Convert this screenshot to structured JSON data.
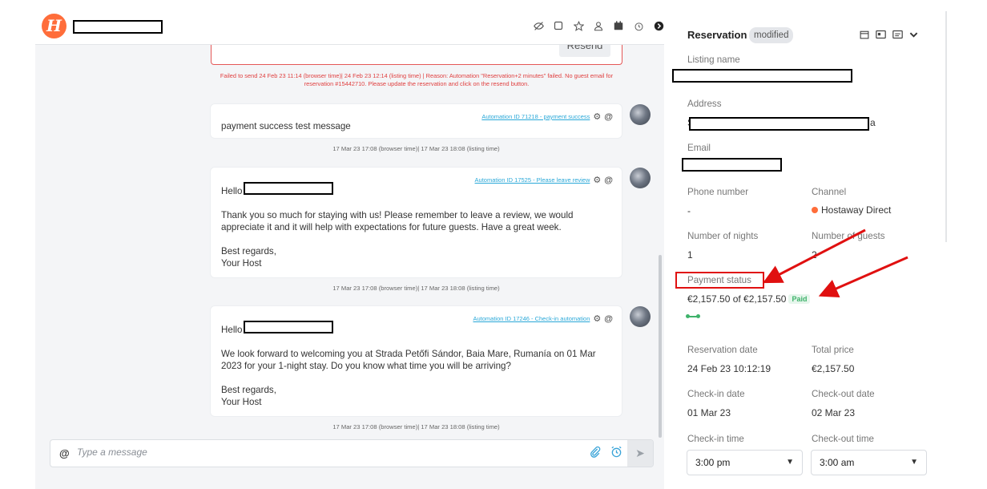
{
  "top_icons": [
    "eye-off-icon",
    "note-icon",
    "star-icon",
    "user-icon",
    "calendar-icon",
    "alarm-icon",
    "arrow-circle-icon"
  ],
  "failed_notice": {
    "resend_label": "Resend",
    "text": "Failed to send 24 Feb 23 11:14  (browser time)|  24 Feb 23 12:14 (listing time)  | Reason: Automation \"Reservation+2 minutes\" failed. No guest email for reservation #15442710. Please update the reservation and click on the resend button."
  },
  "messages": [
    {
      "automation": "Automation ID 71218  -  payment success",
      "greeting": "",
      "paragraphs": [
        "payment success test message"
      ],
      "signature": [],
      "timestamp": "17 Mar 23 17:08  (browser time)|  17 Mar 23 18:08 (listing time)"
    },
    {
      "automation": "Automation ID 17525  -  Please leave review",
      "greeting": "Hello",
      "paragraphs": [
        "Thank you so much for staying with us! Please remember to leave a review, we would appreciate it and it will help with expectations for future guests. Have a great week."
      ],
      "signature": [
        "Best regards,",
        "Your Host"
      ],
      "timestamp": "17 Mar 23 17:08  (browser time)|  17 Mar 23 18:08 (listing time)"
    },
    {
      "automation": "Automation ID 17246  -  Check-in automation",
      "greeting": "Hello",
      "paragraphs": [
        "We look forward to welcoming you at Strada Petőfi Sándor, Baia Mare, Rumanía on 01 Mar 2023 for your 1-night stay. Do you know what time you will be arriving?"
      ],
      "signature": [
        "Best regards,",
        "Your Host"
      ],
      "timestamp": "17 Mar 23 17:08  (browser time)|  17 Mar 23 18:08 (listing time)"
    }
  ],
  "composer": {
    "placeholder": "Type a message"
  },
  "reservation": {
    "title": "Reservation",
    "badge": "modified",
    "listing_label": "Listing name",
    "address_label": "Address",
    "address_prefix": "S",
    "address_suffix": "a",
    "email_label": "Email",
    "phone_label": "Phone number",
    "phone_value": "-",
    "channel_label": "Channel",
    "channel_value": "Hostaway Direct",
    "nights_label": "Number of nights",
    "nights_value": "1",
    "guests_label": "Number of guests",
    "guests_value": "2",
    "payment_label": "Payment status",
    "payment_value": "€2,157.50 of €2,157.50",
    "payment_badge": "Paid",
    "res_date_label": "Reservation date",
    "res_date_value": "24 Feb 23 10:12:19",
    "total_label": "Total price",
    "total_value": "€2,157.50",
    "checkin_date_label": "Check-in date",
    "checkin_date_value": "01 Mar 23",
    "checkout_date_label": "Check-out date",
    "checkout_date_value": "02 Mar 23",
    "checkin_time_label": "Check-in time",
    "checkin_time_value": "3:00 pm",
    "checkout_time_label": "Check-out time",
    "checkout_time_value": "3:00 am"
  },
  "colors": {
    "brand": "#ff6d3a",
    "error": "#e04040",
    "link": "#2aa8d8",
    "paid": "#3fb36b",
    "annotation": "#e01010"
  }
}
